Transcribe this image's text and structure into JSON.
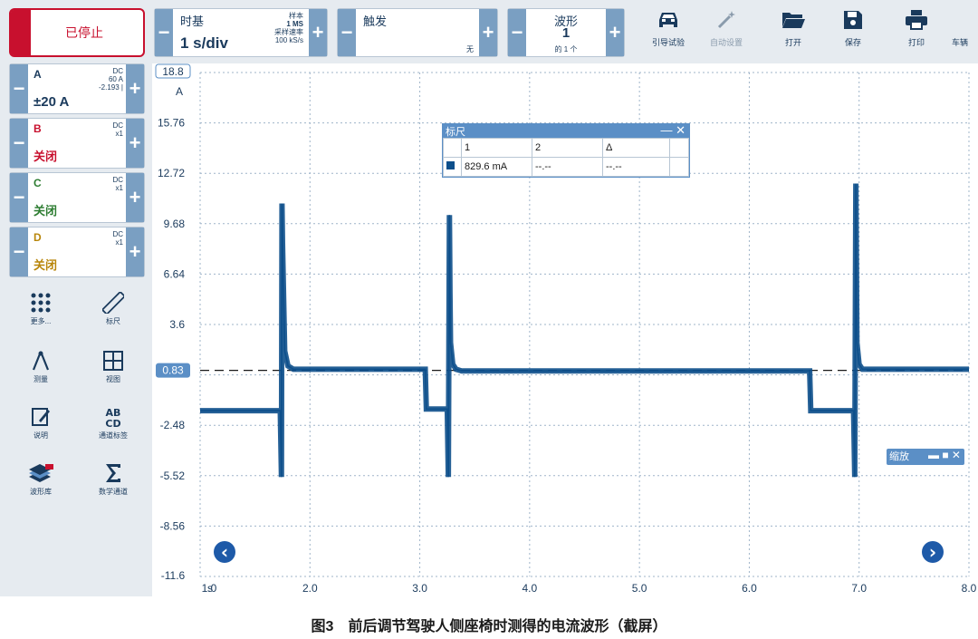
{
  "toolbar": {
    "stop_label": "已停止",
    "timebase": {
      "title": "时基",
      "value": "1 s/div",
      "samples_label": "样本",
      "samples_value": "1 MS",
      "rate_label": "采样速率",
      "rate_value": "100 kS/s"
    },
    "trigger": {
      "title": "触发",
      "mode": "无"
    },
    "waveform": {
      "title": "波形",
      "value": "1",
      "total": "的 1 个"
    },
    "tools": [
      {
        "label": "引导试验",
        "icon": "car-icon"
      },
      {
        "label": "自动设置",
        "icon": "wand-icon"
      },
      {
        "label": "打开",
        "icon": "folder-icon"
      },
      {
        "label": "保存",
        "icon": "save-icon"
      },
      {
        "label": "打印",
        "icon": "print-icon"
      },
      {
        "label": "车辆",
        "icon": "vehicle-icon"
      }
    ]
  },
  "channels": [
    {
      "name": "A",
      "coupling": "DC",
      "info1": "60 A",
      "info2": "-2.193 |",
      "value": "±20 A",
      "color": "#1a3a5c"
    },
    {
      "name": "B",
      "coupling": "DC",
      "info1": "x1",
      "info2": "",
      "value": "关闭",
      "color": "#c8102e"
    },
    {
      "name": "C",
      "coupling": "DC",
      "info1": "x1",
      "info2": "",
      "value": "关闭",
      "color": "#2e7d32"
    },
    {
      "name": "D",
      "coupling": "DC",
      "info1": "x1",
      "info2": "",
      "value": "关闭",
      "color": "#b8860b"
    }
  ],
  "left_tools": [
    {
      "label": "更多...",
      "icon": "grid-dots-icon"
    },
    {
      "label": "标尺",
      "icon": "ruler-icon"
    },
    {
      "label": "测量",
      "icon": "compass-icon"
    },
    {
      "label": "视图",
      "icon": "view-grid-icon"
    },
    {
      "label": "说明",
      "icon": "note-icon"
    },
    {
      "label": "通道标签",
      "icon": "channel-label-icon"
    },
    {
      "label": "波形库",
      "icon": "waveform-library-icon"
    },
    {
      "label": "数学通道",
      "icon": "sigma-icon"
    }
  ],
  "ruler_panel": {
    "title": "标尺",
    "col1": "1",
    "col2": "2",
    "col3": "Δ",
    "val1": "829.6 mA",
    "val2": "--.--",
    "val3": "--.--"
  },
  "zoom_label": "缩放",
  "caption": "图3　前后调节驾驶人侧座椅时测得的电流波形（截屏）",
  "colors": {
    "trace": "#0d4f8b",
    "accent": "#5b8fc6",
    "stop": "#c8102e"
  },
  "chart_data": {
    "type": "line",
    "y_unit_label": "A",
    "x_unit_label": "s",
    "yticks": [
      "18.8",
      "15.76",
      "12.72",
      "9.68",
      "6.64",
      "3.6",
      "0.83",
      "-2.48",
      "-5.52",
      "-8.56",
      "-11.6"
    ],
    "ytick_values": [
      18.8,
      15.76,
      12.72,
      9.68,
      6.64,
      3.6,
      0.83,
      -2.48,
      -5.52,
      -8.56,
      -11.6
    ],
    "xticks": [
      "1.0",
      "2.0",
      "3.0",
      "4.0",
      "5.0",
      "6.0",
      "7.0",
      "8.0"
    ],
    "ylim": [
      -11.6,
      18.8
    ],
    "xlim": [
      1.0,
      8.0
    ],
    "ruler_level": 0.83,
    "grid": true,
    "series": [
      {
        "x": [
          1.0,
          1.73,
          1.74,
          1.745,
          1.75,
          1.77,
          1.8,
          1.85,
          3.05,
          3.06,
          3.25,
          3.26,
          3.27,
          3.275,
          3.28,
          3.3,
          3.33,
          3.38,
          6.55,
          6.56,
          6.95,
          6.96,
          6.97,
          6.975,
          6.98,
          7.0,
          7.03,
          7.08,
          8.0
        ],
        "y": [
          -1.6,
          -1.6,
          -5.6,
          10.9,
          8.5,
          2.0,
          1.1,
          0.9,
          0.9,
          -1.5,
          -1.5,
          -5.6,
          10.2,
          5.5,
          2.5,
          1.2,
          0.9,
          0.8,
          0.8,
          -1.6,
          -1.6,
          -5.6,
          12.1,
          7.5,
          2.5,
          1.2,
          0.9,
          0.9,
          0.9
        ]
      }
    ]
  }
}
